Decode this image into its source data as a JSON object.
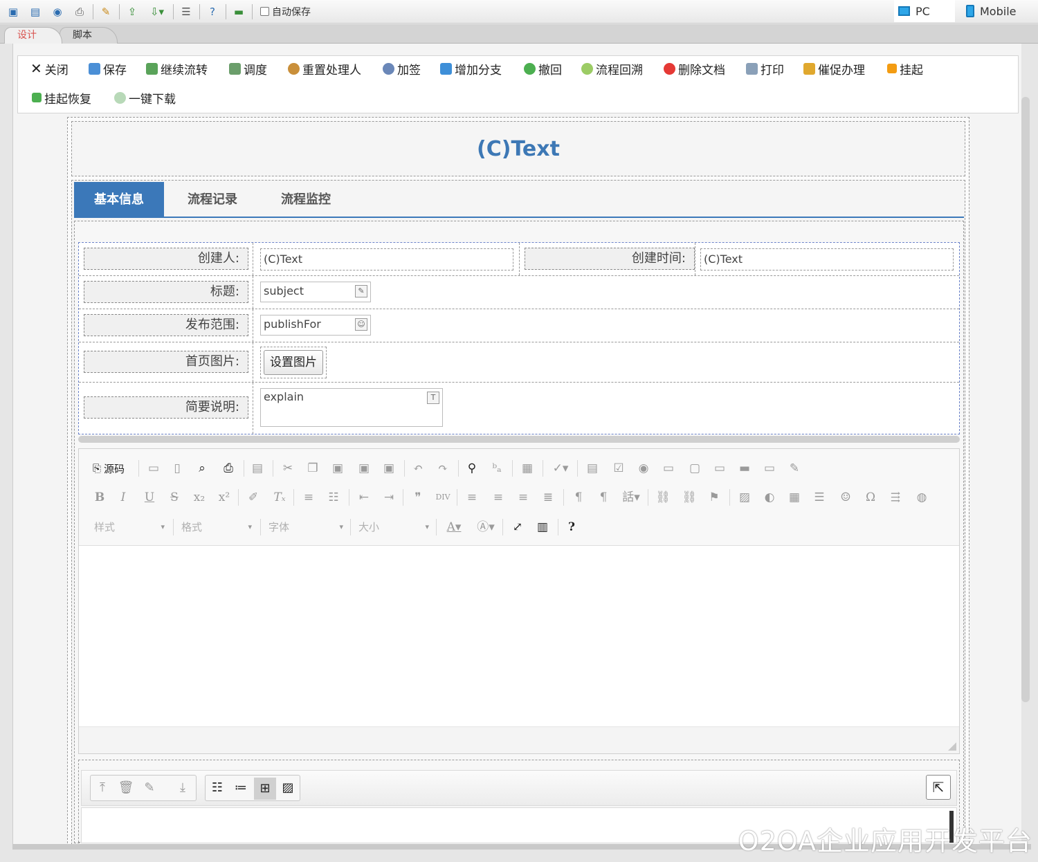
{
  "designer_toolbar": {
    "auto_save_label": "自动保存",
    "view_pc": "PC",
    "view_mobile": "Mobile"
  },
  "mode_tabs": {
    "design": "设计",
    "script": "脚本"
  },
  "actions": {
    "close": "关闭",
    "save": "保存",
    "continue_flow": "继续流转",
    "dispatch": "调度",
    "reset_handler": "重置处理人",
    "add_sign": "加签",
    "add_branch": "增加分支",
    "retract": "撤回",
    "flow_rollback": "流程回溯",
    "delete_doc": "删除文档",
    "print": "打印",
    "urge": "催促办理",
    "suspend": "挂起",
    "resume": "挂起恢复",
    "download_all": "一键下载"
  },
  "form": {
    "title": "(C)Text",
    "tabs": [
      "基本信息",
      "流程记录",
      "流程监控"
    ],
    "creator_label": "创建人:",
    "creator_value": "(C)Text",
    "created_time_label": "创建时间:",
    "created_time_value": "(C)Text",
    "subject_label": "标题:",
    "subject_value": "subject",
    "publish_label": "发布范围:",
    "publish_value": "publishFor",
    "image_label": "首页图片:",
    "image_button": "设置图片",
    "explain_label": "简要说明:",
    "explain_value": "explain"
  },
  "editor": {
    "source_label": "源码",
    "combo_style": "样式",
    "combo_format": "格式",
    "combo_font": "字体",
    "combo_size": "大小",
    "help": "?"
  },
  "watermark": "O2OA企业应用开发平台",
  "colors": {
    "accent": "#3b78b9",
    "title": "#3d78b5",
    "design_tab": "#d9534f"
  }
}
